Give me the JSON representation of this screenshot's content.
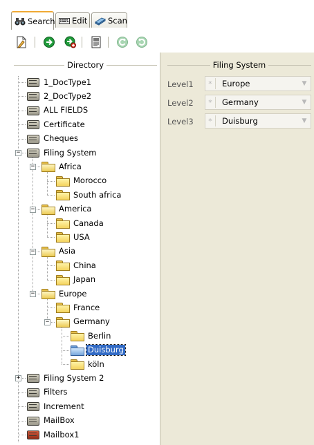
{
  "tabs": [
    {
      "label": "Search",
      "icon": "binoculars-icon",
      "active": true
    },
    {
      "label": "Edit",
      "icon": "keyboard-icon",
      "active": false
    },
    {
      "label": "Scan",
      "icon": "scanner-icon",
      "active": false
    }
  ],
  "toolbar": [
    {
      "name": "new-document-icon"
    },
    {
      "name": "go-arrow-icon"
    },
    {
      "name": "add-go-icon"
    },
    {
      "name": "document-list-icon"
    },
    {
      "name": "refresh-icon"
    },
    {
      "name": "refresh-forward-icon"
    }
  ],
  "directory": {
    "title": "Directory",
    "nodes": [
      {
        "label": "1_DocType1",
        "icon": "cabinet",
        "depth": 0
      },
      {
        "label": "2_DocType2",
        "icon": "cabinet",
        "depth": 0
      },
      {
        "label": "ALL FIELDS",
        "icon": "cabinet",
        "depth": 0
      },
      {
        "label": "Certificate",
        "icon": "cabinet",
        "depth": 0
      },
      {
        "label": "Cheques",
        "icon": "cabinet",
        "depth": 0
      },
      {
        "label": "Filing System",
        "icon": "cabinet",
        "depth": 0,
        "expander": "−"
      },
      {
        "label": "Africa",
        "icon": "folder-open",
        "depth": 1,
        "expander": "−"
      },
      {
        "label": "Morocco",
        "icon": "folder",
        "depth": 2
      },
      {
        "label": "South africa",
        "icon": "folder",
        "depth": 2
      },
      {
        "label": "America",
        "icon": "folder-open",
        "depth": 1,
        "expander": "−"
      },
      {
        "label": "Canada",
        "icon": "folder",
        "depth": 2
      },
      {
        "label": "USA",
        "icon": "folder",
        "depth": 2
      },
      {
        "label": "Asia",
        "icon": "folder-open",
        "depth": 1,
        "expander": "−"
      },
      {
        "label": "China",
        "icon": "folder",
        "depth": 2
      },
      {
        "label": "Japan",
        "icon": "folder",
        "depth": 2
      },
      {
        "label": "Europe",
        "icon": "folder-open",
        "depth": 1,
        "expander": "−"
      },
      {
        "label": "France",
        "icon": "folder",
        "depth": 2
      },
      {
        "label": "Germany",
        "icon": "folder-open",
        "depth": 2,
        "expander": "−"
      },
      {
        "label": "Berlin",
        "icon": "folder",
        "depth": 3
      },
      {
        "label": "Duisburg",
        "icon": "folder-blue",
        "depth": 3,
        "selected": true
      },
      {
        "label": "köln",
        "icon": "folder",
        "depth": 3
      },
      {
        "label": "Filing System 2",
        "icon": "cabinet",
        "depth": 0,
        "expander": "+"
      },
      {
        "label": "Filters",
        "icon": "cabinet",
        "depth": 0
      },
      {
        "label": "Increment",
        "icon": "cabinet",
        "depth": 0
      },
      {
        "label": "MailBox",
        "icon": "cabinet",
        "depth": 0
      },
      {
        "label": "Mailbox1",
        "icon": "cabinet-red",
        "depth": 0
      }
    ]
  },
  "filing_system": {
    "title": "Filing System",
    "levels": [
      {
        "label": "Level1",
        "value": "Europe",
        "required_mark": "*"
      },
      {
        "label": "Level2",
        "value": "Germany",
        "required_mark": "*"
      },
      {
        "label": "Level3",
        "value": "Duisburg",
        "required_mark": "*"
      }
    ]
  },
  "colors": {
    "selection": "#316ac5",
    "panel": "#ece9d8",
    "tab_highlight": "#f0a934"
  }
}
